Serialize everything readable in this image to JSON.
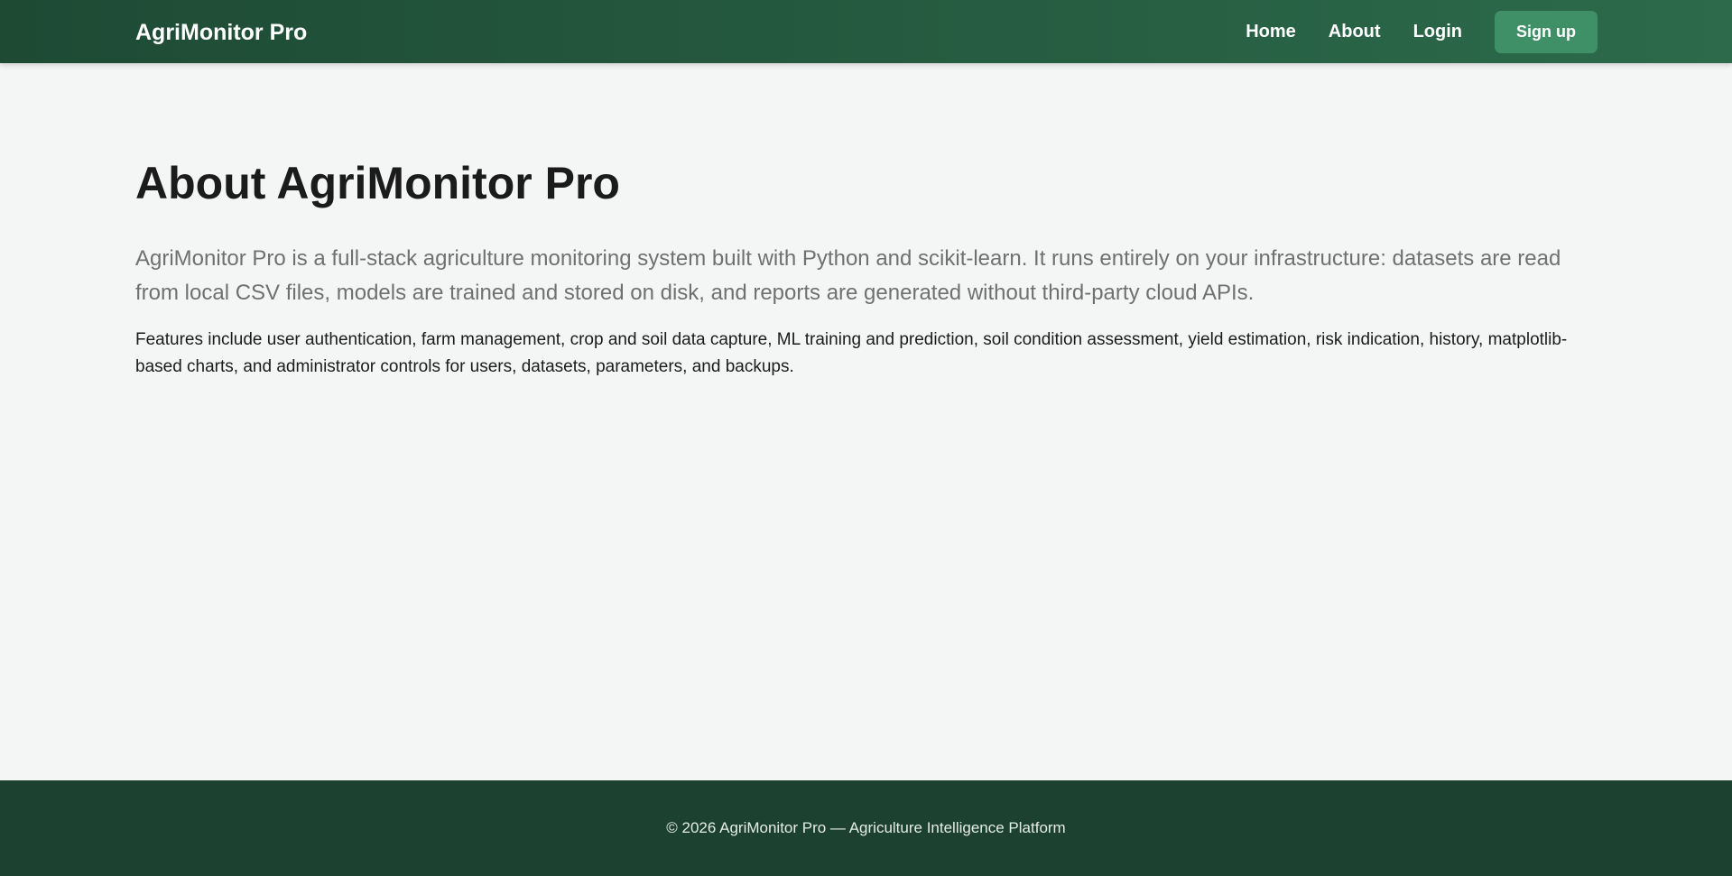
{
  "header": {
    "brand": "AgriMonitor Pro",
    "nav": {
      "home": "Home",
      "about": "About",
      "login": "Login",
      "signup": "Sign up"
    }
  },
  "main": {
    "title": "About AgriMonitor Pro",
    "lead": "AgriMonitor Pro is a full-stack agriculture monitoring system built with Python and scikit-learn. It runs entirely on your infrastructure: datasets are read from local CSV files, models are trained and stored on disk, and reports are generated without third-party cloud APIs.",
    "features": "Features include user authentication, farm management, crop and soil data capture, ML training and prediction, soil condition assessment, yield estimation, risk indication, history, matplotlib-based charts, and administrator controls for users, datasets, parameters, and backups."
  },
  "footer": {
    "text": "© 2026 AgriMonitor Pro — Agriculture Intelligence Platform"
  },
  "colors": {
    "header_start": "#1e4a34",
    "header_end": "#2c6a4b",
    "signup_button": "#3f8f67",
    "footer": "#1c4130",
    "background": "#f4f6f5"
  }
}
